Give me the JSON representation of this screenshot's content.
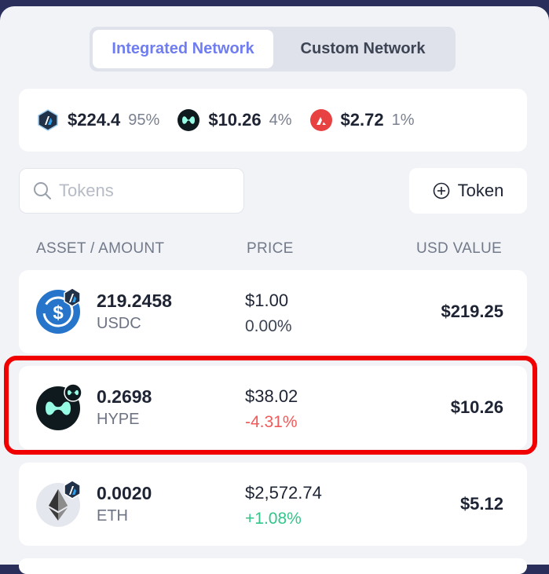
{
  "tabs": [
    {
      "label": "Integrated Network",
      "active": true
    },
    {
      "label": "Custom Network",
      "active": false
    }
  ],
  "summary": [
    {
      "icon": "arbitrum-icon",
      "value": "$224.4",
      "percent": "95%"
    },
    {
      "icon": "hyperliquid-icon",
      "value": "$10.26",
      "percent": "4%"
    },
    {
      "icon": "avalanche-icon",
      "value": "$2.72",
      "percent": "1%"
    }
  ],
  "search": {
    "placeholder": "Tokens"
  },
  "add_token": {
    "label": "Token"
  },
  "columns": {
    "asset": "ASSET / AMOUNT",
    "price": "PRICE",
    "usd": "USD VALUE"
  },
  "assets": [
    {
      "amount": "219.2458",
      "symbol": "USDC",
      "price": "$1.00",
      "change": "0.00%",
      "change_dir": "flat",
      "usd": "$219.25",
      "icon": "usdc-icon",
      "network_badge": "arbitrum-icon"
    },
    {
      "amount": "0.2698",
      "symbol": "HYPE",
      "price": "$38.02",
      "change": "-4.31%",
      "change_dir": "down",
      "usd": "$10.26",
      "icon": "hype-icon",
      "network_badge": "hyperliquid-icon"
    },
    {
      "amount": "0.0020",
      "symbol": "ETH",
      "price": "$2,572.74",
      "change": "+1.08%",
      "change_dir": "up",
      "usd": "$5.12",
      "icon": "eth-icon",
      "network_badge": "arbitrum-icon"
    }
  ],
  "colors": {
    "accent": "#6f7df0",
    "negative": "#f05a5a",
    "positive": "#33c58a",
    "highlight": "#f00000"
  }
}
